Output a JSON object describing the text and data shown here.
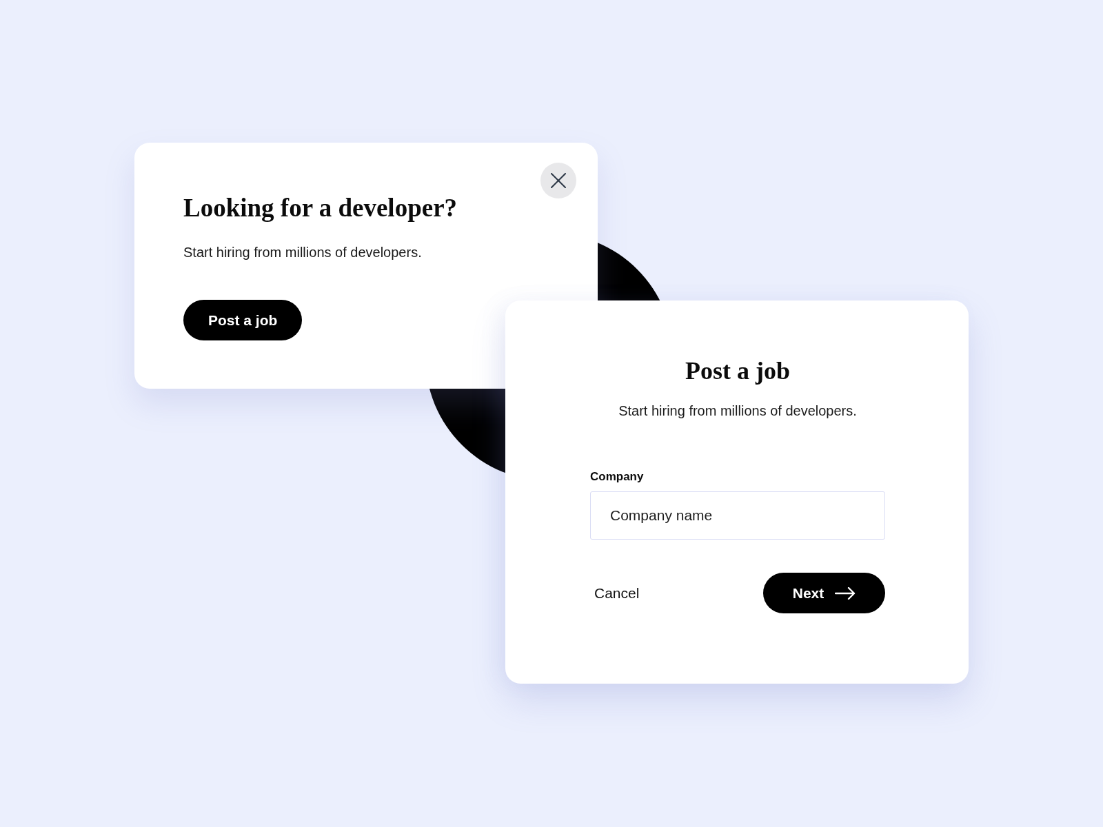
{
  "promo_card": {
    "title": "Looking for a developer?",
    "subtitle": "Start hiring from millions of developers.",
    "button": "Post a job"
  },
  "form_card": {
    "title": "Post a job",
    "subtitle": "Start hiring from millions of developers.",
    "field": {
      "label": "Company",
      "placeholder": "Company name"
    },
    "buttons": [
      {
        "label": "Cancel",
        "kind": "link"
      },
      {
        "label": "Next",
        "kind": "primary"
      }
    ]
  }
}
